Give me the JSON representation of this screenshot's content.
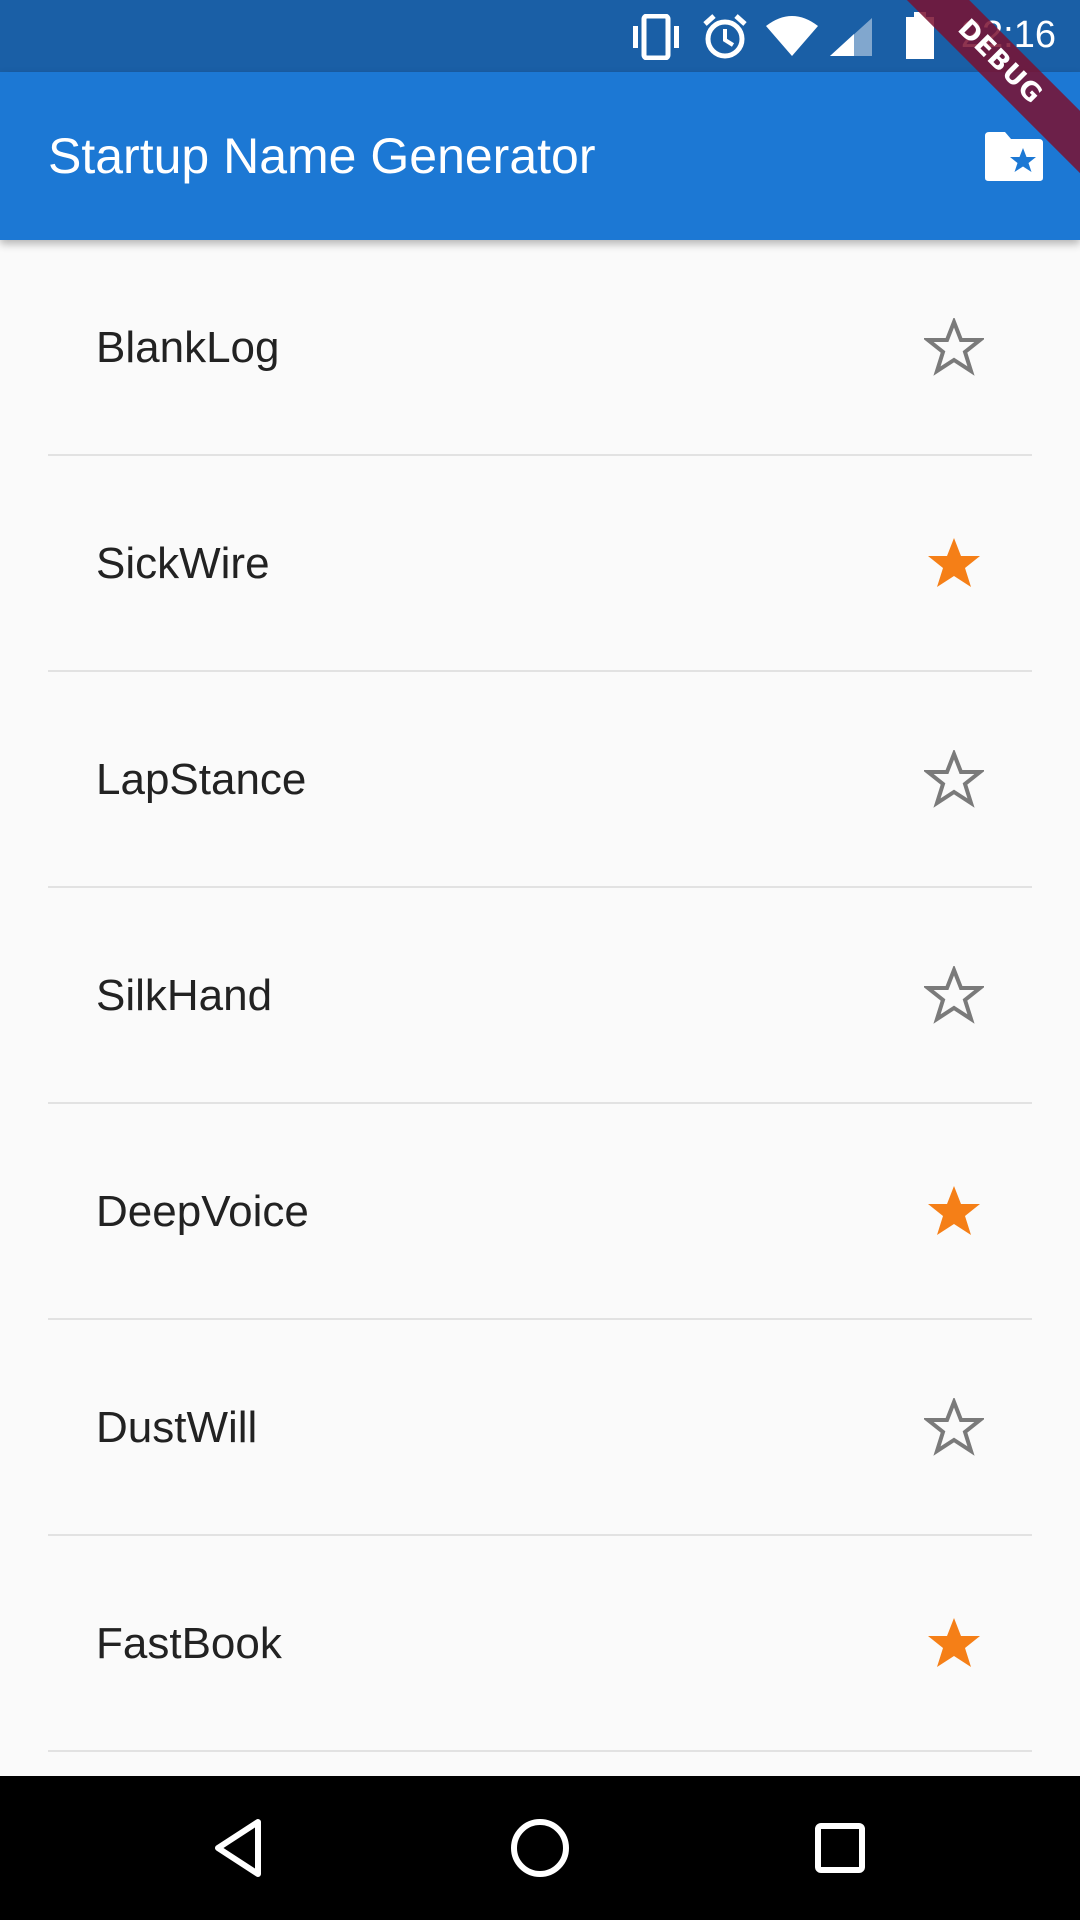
{
  "status_bar": {
    "time": "22:16",
    "icons": [
      "vibrate-icon",
      "alarm-icon",
      "wifi-icon",
      "signal-icon",
      "battery-icon"
    ]
  },
  "debug_banner": "DEBUG",
  "app_bar": {
    "title": "Startup Name Generator",
    "action_icon": "saved-folder-star-icon"
  },
  "colors": {
    "status_bar": "#1a5fa6",
    "app_bar": "#1c78d4",
    "star_filled": "#f57f17",
    "star_outline": "#7a7a7a",
    "background": "#fafafa"
  },
  "list": {
    "items": [
      {
        "name": "BlankLog",
        "saved": false
      },
      {
        "name": "SickWire",
        "saved": true
      },
      {
        "name": "LapStance",
        "saved": false
      },
      {
        "name": "SilkHand",
        "saved": false
      },
      {
        "name": "DeepVoice",
        "saved": true
      },
      {
        "name": "DustWill",
        "saved": false
      },
      {
        "name": "FastBook",
        "saved": true
      }
    ]
  },
  "nav_bar": {
    "buttons": [
      "back-icon",
      "home-icon",
      "recents-icon"
    ]
  }
}
